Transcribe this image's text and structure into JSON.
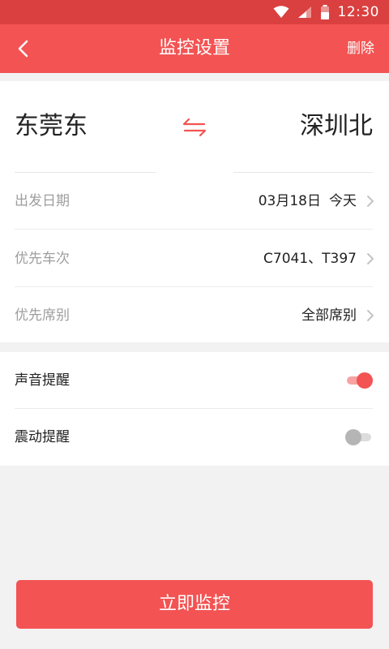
{
  "status_bar": {
    "time": "12:30",
    "icons": [
      "wifi-icon",
      "signal-icon",
      "battery-icon"
    ]
  },
  "header": {
    "title": "监控设置",
    "delete_label": "删除",
    "icons": [
      "back-arrow-icon"
    ]
  },
  "route": {
    "from_station": "东莞东",
    "to_station": "深圳北",
    "swap_icon": "swap-arrows-icon"
  },
  "settings": {
    "departure_date": {
      "label": "出发日期",
      "value": "03月18日",
      "today": "今天"
    },
    "preferred_trains": {
      "label": "优先车次",
      "value": "C7041、T397"
    },
    "preferred_seat": {
      "label": "优先席别",
      "value": "全部席别"
    }
  },
  "toggles": {
    "sound": {
      "label": "声音提醒",
      "on": true
    },
    "vibration": {
      "label": "震动提醒",
      "on": false
    }
  },
  "actions": {
    "monitor_now": "立即监控"
  },
  "colors": {
    "accent": "#f35353",
    "status_bar": "#d9403f",
    "background": "#f2f2f2"
  }
}
